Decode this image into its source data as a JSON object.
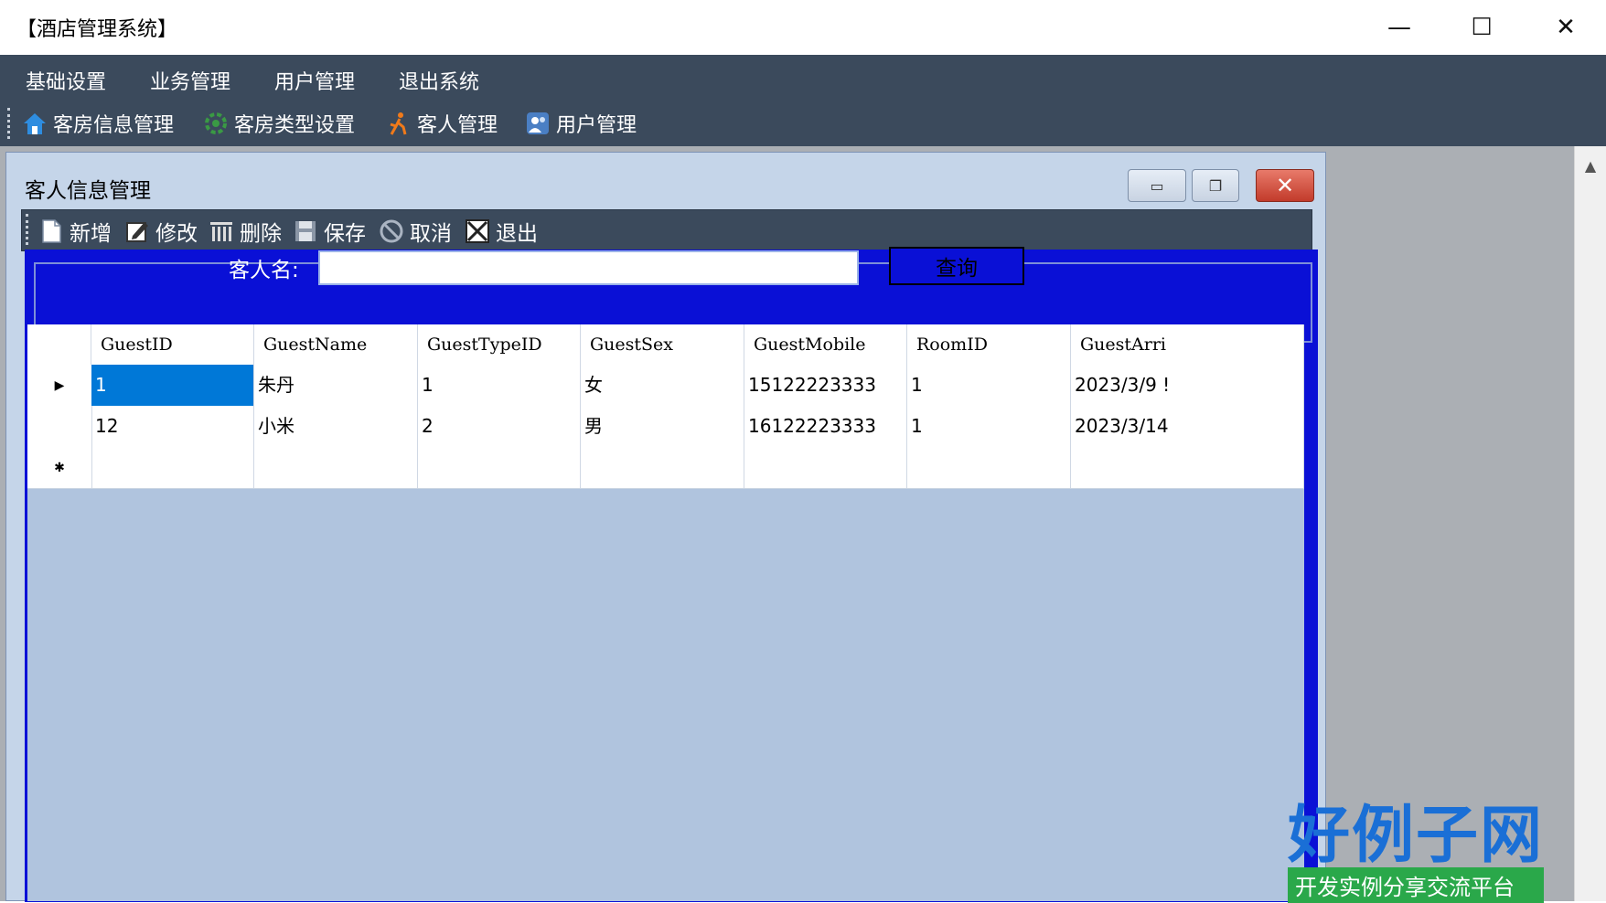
{
  "window": {
    "title": "【酒店管理系统】",
    "minimize": "—",
    "maximize": "☐",
    "close": "✕"
  },
  "menu": [
    "基础设置",
    "业务管理",
    "用户管理",
    "退出系统"
  ],
  "toolbar": [
    {
      "label": "客房信息管理",
      "icon": "house-icon"
    },
    {
      "label": "客房类型设置",
      "icon": "settings-icon"
    },
    {
      "label": "客人管理",
      "icon": "person-icon"
    },
    {
      "label": "用户管理",
      "icon": "users-icon"
    }
  ],
  "child": {
    "title": "客人信息管理",
    "buttons": {
      "minimize": "▭",
      "restore": "❐",
      "close": "✕"
    },
    "toolbar": [
      {
        "label": "新增",
        "icon": "new-icon"
      },
      {
        "label": "修改",
        "icon": "edit-icon"
      },
      {
        "label": "删除",
        "icon": "delete-icon"
      },
      {
        "label": "保存",
        "icon": "save-icon"
      },
      {
        "label": "取消",
        "icon": "cancel-icon"
      },
      {
        "label": "退出",
        "icon": "exit-icon"
      }
    ],
    "search": {
      "label": "客人名:",
      "value": "",
      "button": "查询"
    },
    "grid": {
      "columns": [
        "GuestID",
        "GuestName",
        "GuestTypeID",
        "GuestSex",
        "GuestMobile",
        "RoomID",
        "GuestArri"
      ],
      "rows": [
        {
          "indicator": "▶",
          "cells": [
            "1",
            "朱丹",
            "1",
            "女",
            "15122223333",
            "1",
            "2023/3/9 !"
          ]
        },
        {
          "indicator": "",
          "cells": [
            "12",
            "小米",
            "2",
            "男",
            "16122223333",
            "1",
            "2023/3/14"
          ]
        },
        {
          "indicator": "✱",
          "cells": [
            "",
            "",
            "",
            "",
            "",
            "",
            ""
          ]
        }
      ]
    }
  },
  "watermark": {
    "brand": "好例子网",
    "slogan": "开发实例分享交流平台"
  },
  "colors": {
    "menubar": "#3b4a5c",
    "panel": "#0a10d6",
    "grid_bg": "#b0c4de",
    "selection": "#0078d7"
  }
}
